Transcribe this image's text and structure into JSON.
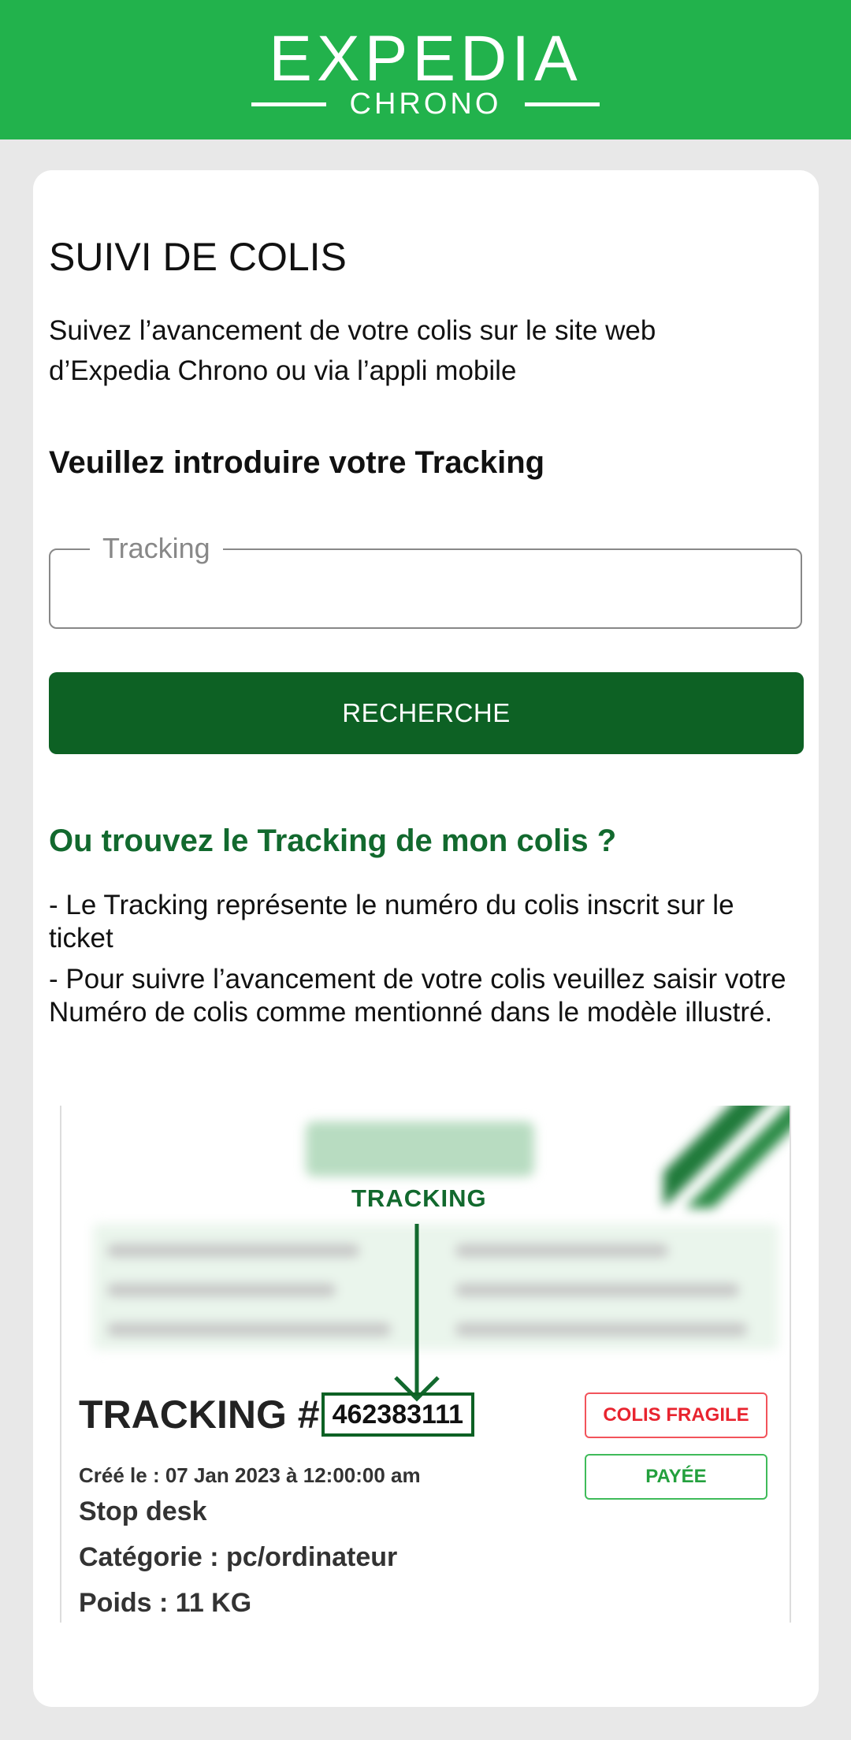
{
  "header": {
    "brand": "EXPEDIA",
    "sub": "CHRONO",
    "color": "#22b24c"
  },
  "page": {
    "title": "SUIVI DE COLIS",
    "intro": "Suivez l’avancement de votre colis sur le site web d’Expedia Chrono ou via l’appli mobile",
    "prompt": "Veuillez introduire votre Tracking"
  },
  "form": {
    "tracking_label": "Tracking",
    "tracking_value": "",
    "search_button": "RECHERCHE",
    "button_color": "#0d6124"
  },
  "faq": {
    "title": "Ou trouvez le Tracking de mon colis ?",
    "lines": [
      "- Le Tracking représente le numéro du colis inscrit sur le ticket",
      "- Pour suivre l’avancement de votre colis veuillez saisir votre Numéro de colis comme mentionné dans le modèle illustré."
    ]
  },
  "example": {
    "arrow_label": "TRACKING",
    "tracking_prefix": "TRACKING #",
    "tracking_number": "462383111",
    "created": "Créé le : 07 Jan 2023 à 12:00:00 am",
    "delivery": "Stop desk",
    "category": "Catégorie : pc/ordinateur",
    "weight": "Poids : 11 KG",
    "badge_fragile": "COLIS FRAGILE",
    "badge_paid": "PAYÉE"
  }
}
